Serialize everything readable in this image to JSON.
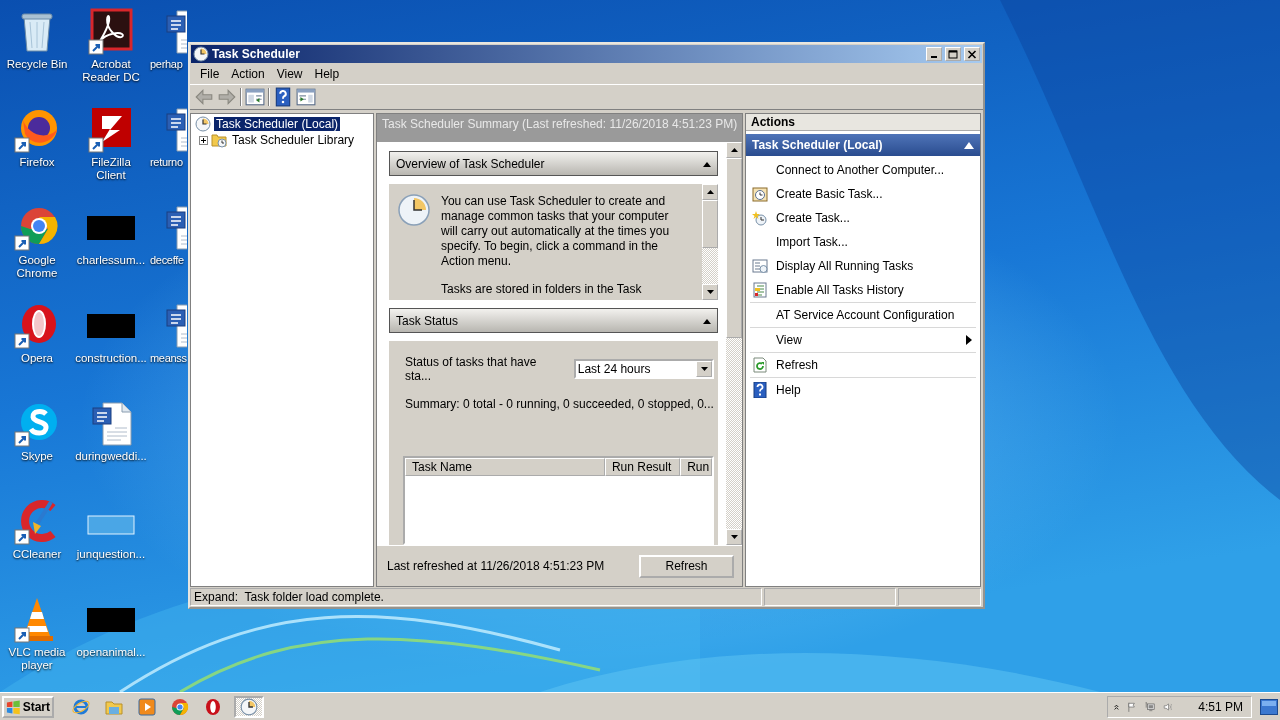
{
  "desktop": {
    "icons": [
      {
        "label": "Recycle Bin",
        "kind": "recycle",
        "shortcut": false
      },
      {
        "label": "Firefox",
        "kind": "firefox",
        "shortcut": true
      },
      {
        "label": "Google Chrome",
        "kind": "chrome",
        "shortcut": true
      },
      {
        "label": "Opera",
        "kind": "opera",
        "shortcut": true
      },
      {
        "label": "Skype",
        "kind": "skype",
        "shortcut": true
      },
      {
        "label": "CCleaner",
        "kind": "ccleaner",
        "shortcut": true
      },
      {
        "label": "VLC media player",
        "kind": "vlc",
        "shortcut": true
      },
      {
        "label": "Acrobat Reader DC",
        "kind": "acrobat",
        "shortcut": true
      },
      {
        "label": "FileZilla Client",
        "kind": "filezilla",
        "shortcut": true
      },
      {
        "label": "charlessum...",
        "kind": "thumbnail",
        "shortcut": false
      },
      {
        "label": "construction...",
        "kind": "thumbnail",
        "shortcut": false
      },
      {
        "label": "duringweddi...",
        "kind": "word",
        "shortcut": false
      },
      {
        "label": "junquestion...",
        "kind": "blank",
        "shortcut": false
      },
      {
        "label": "openanimal...",
        "kind": "thumbnail",
        "shortcut": false
      },
      {
        "label": "perhap",
        "kind": "word",
        "shortcut": false
      },
      {
        "label": "returno",
        "kind": "word",
        "shortcut": false
      },
      {
        "label": "deceffe",
        "kind": "word",
        "shortcut": false
      },
      {
        "label": "meanss",
        "kind": "word",
        "shortcut": false
      }
    ]
  },
  "window": {
    "title": "Task Scheduler",
    "menu": [
      "File",
      "Action",
      "View",
      "Help"
    ],
    "toolbar": [
      {
        "kind": "back",
        "disabled": true
      },
      {
        "kind": "forward",
        "disabled": true
      },
      {
        "kind": "separator"
      },
      {
        "kind": "tree-toggle"
      },
      {
        "kind": "separator"
      },
      {
        "kind": "help"
      },
      {
        "kind": "pane-toggle"
      }
    ],
    "tree": [
      {
        "label": "Task Scheduler (Local)",
        "selected": true,
        "children": [
          {
            "label": "Task Scheduler Library",
            "selected": false,
            "expanded": false
          }
        ]
      }
    ],
    "summary": {
      "title": "Task Scheduler Summary (Last refreshed: 11/26/2018 4:51:23 PM)",
      "sections": [
        {
          "kind": "overview",
          "title": "Overview of Task Scheduler",
          "paragraphs": [
            "You can use Task Scheduler to create and manage common tasks that your computer will carry out automatically at the times you specify. To begin, click a command in the Action menu.",
            "Tasks are stored in folders in the Task"
          ]
        },
        {
          "kind": "status",
          "title": "Task Status",
          "filter_label": "Status of tasks that have sta...",
          "filter_value": "Last 24 hours",
          "summary": "Summary: 0 total - 0 running, 0 succeeded, 0 stopped, 0...",
          "columns": [
            "Task Name",
            "Run Result",
            "Run"
          ]
        }
      ],
      "footer_text": "Last refreshed at 11/26/2018 4:51:23 PM",
      "footer_button": "Refresh"
    },
    "actions": {
      "title": "Actions",
      "group": "Task Scheduler (Local)",
      "groups": [
        [
          {
            "label": "Connect to Another Computer...",
            "kind": "plain"
          },
          {
            "label": "Create Basic Task...",
            "kind": "basic-task"
          },
          {
            "label": "Create Task...",
            "kind": "create-task"
          },
          {
            "label": "Import Task...",
            "kind": "plain"
          },
          {
            "label": "Display All Running Tasks",
            "kind": "running"
          },
          {
            "label": "Enable All Tasks History",
            "kind": "history"
          }
        ],
        [
          {
            "label": "AT Service Account Configuration",
            "kind": "plain"
          }
        ],
        [
          {
            "label": "View",
            "kind": "plain",
            "submenu": true
          }
        ],
        [
          {
            "label": "Refresh",
            "kind": "refresh"
          }
        ],
        [
          {
            "label": "Help",
            "kind": "help"
          }
        ]
      ]
    },
    "status_bar": {
      "text": "Expand:  Task folder load complete."
    }
  },
  "taskbar": {
    "start": "Start",
    "quick_launch": [
      {
        "kind": "ie"
      },
      {
        "kind": "folder"
      },
      {
        "kind": "media"
      },
      {
        "kind": "chrome"
      },
      {
        "kind": "opera"
      }
    ],
    "tasks": [
      {
        "kind": "clock",
        "selected": true
      }
    ],
    "tray": {
      "icons": [
        {
          "kind": "chevron"
        },
        {
          "kind": "flag"
        },
        {
          "kind": "network"
        },
        {
          "kind": "speaker"
        }
      ],
      "time": "4:51 PM"
    }
  }
}
